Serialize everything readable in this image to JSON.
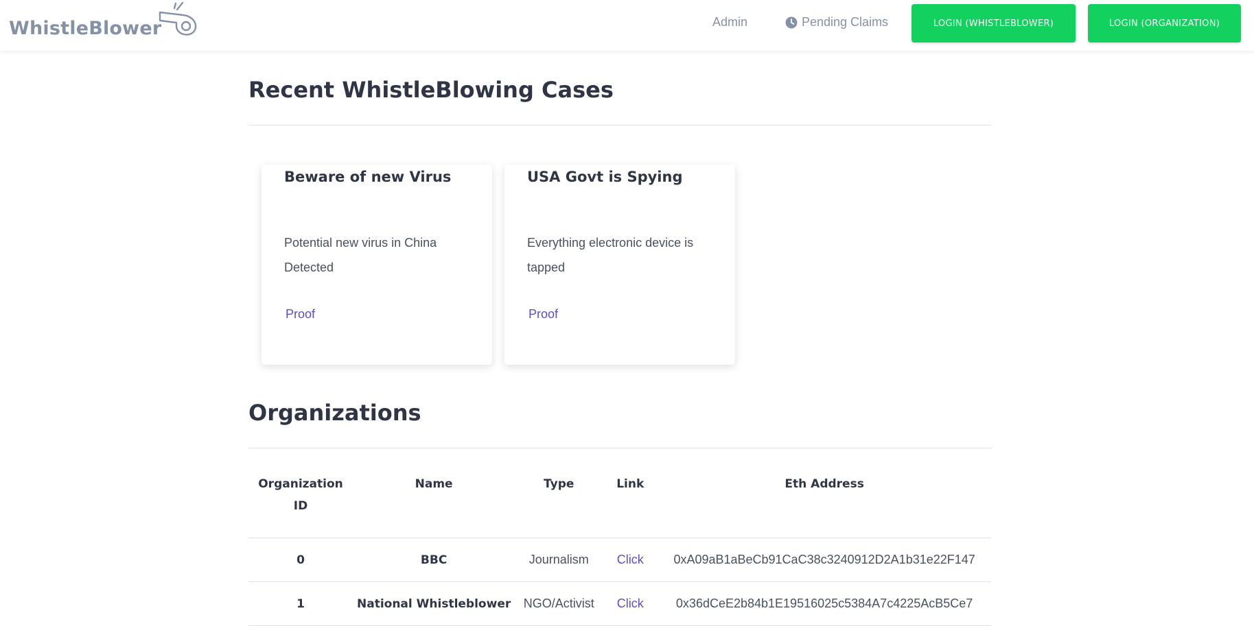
{
  "nav": {
    "brand": "WhistleBlower",
    "admin": "Admin",
    "pending_claims": "Pending Claims",
    "login_whistleblower": "LOGIN (WHISTLEBLOWER)",
    "login_organization": "LOGIN (ORGANIZATION)"
  },
  "cases": {
    "title": "Recent WhistleBlowing Cases",
    "items": [
      {
        "title": "Beware of new Virus",
        "text": "Potential new virus in China Detected",
        "link": "Proof"
      },
      {
        "title": "USA Govt is Spying",
        "text": "Everything electronic device is tapped",
        "link": "Proof"
      }
    ]
  },
  "orgs": {
    "title": "Organizations",
    "headers": [
      "Organization ID",
      "Name",
      "Type",
      "Link",
      "Eth Address"
    ],
    "rows": [
      {
        "id": "0",
        "name": "BBC",
        "type": "Journalism",
        "link": "Click",
        "eth": "0xA09aB1aBeCb91CaC38c3240912D2A1b31e22F147"
      },
      {
        "id": "1",
        "name": "National Whistleblower",
        "type": "NGO/Activist",
        "link": "Click",
        "eth": "0x36dCeE2b84b1E19516025c5384A7c4225AcB5Ce7"
      }
    ]
  },
  "colors": {
    "accent": "#12d15f",
    "link": "#5a4fc9",
    "nav_text": "#8592a6",
    "heading": "#2f3545"
  }
}
